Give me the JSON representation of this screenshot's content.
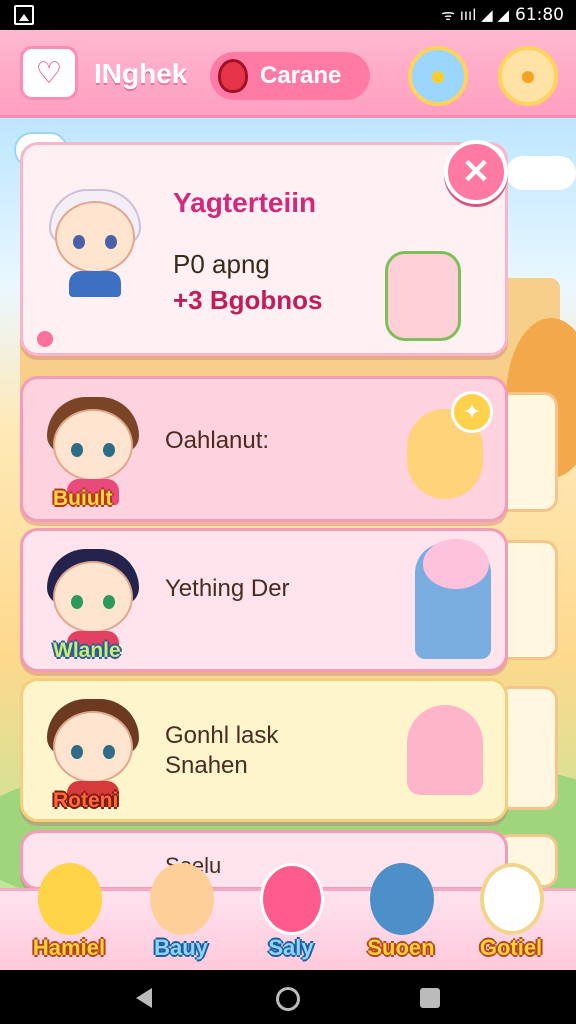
{
  "status_bar": {
    "time": "61:80",
    "signals": "ᯤ ıııl ◢ ◢"
  },
  "header": {
    "title": "INghek",
    "currency_label": "Carane",
    "logo_icon": "heart-tag-icon",
    "icon_one": "chick-chat-icon",
    "icon_two": "chick-icon"
  },
  "popup": {
    "title": "Yagterteiin",
    "line1": "P0 apng",
    "line2": "+3 Bgobnos",
    "close_glyph": "✕"
  },
  "cards": [
    {
      "title": "Oahlanut:",
      "name": "Buiult",
      "bg": "#ffd2df"
    },
    {
      "title": "Yething Der",
      "name": "Wlanle",
      "bg": "#ffe4ee"
    },
    {
      "title": "Gonhl lask\nSnahen",
      "name": "Roteni",
      "bg": "#fff5cd"
    },
    {
      "title": "Seelu",
      "name": "",
      "bg": "#ffe4ee"
    }
  ],
  "bottom_nav": [
    {
      "label": "Hamiel",
      "color": "yellow"
    },
    {
      "label": "Bauy",
      "color": "blue"
    },
    {
      "label": "Saly",
      "color": "blue"
    },
    {
      "label": "Suoen",
      "color": "yellow"
    },
    {
      "label": "Gotiel",
      "color": "yellow"
    }
  ]
}
